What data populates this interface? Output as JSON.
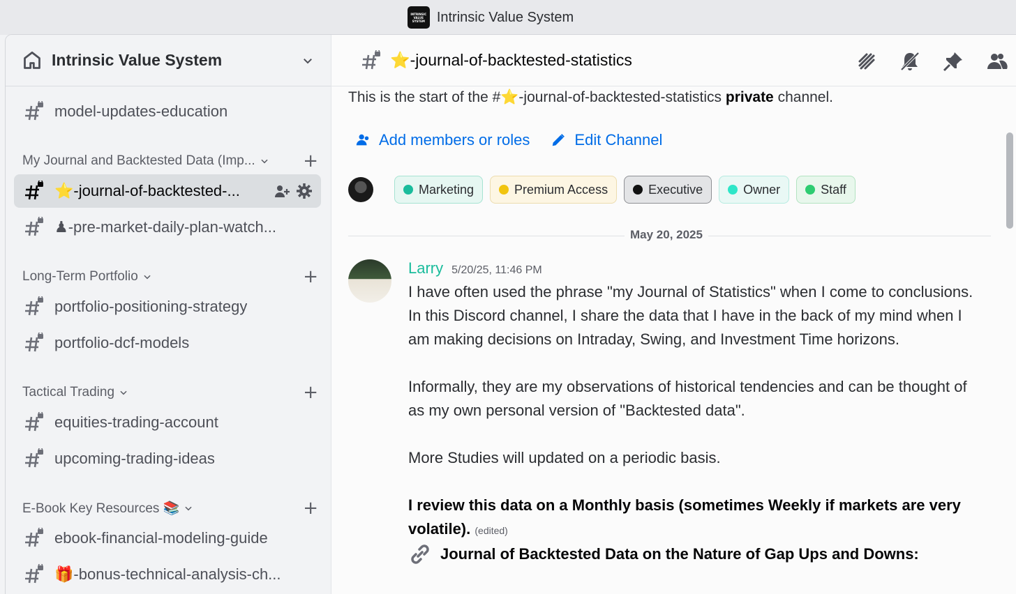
{
  "window": {
    "title": "Intrinsic Value System",
    "logo_text": "INTRINSIC VALUE SYSTEM"
  },
  "sidebar": {
    "server_name": "Intrinsic Value System",
    "top_channel": "model-updates-education",
    "categories": [
      {
        "label": "My Journal and Backtested Data (Imp...",
        "channels": [
          "⭐-journal-of-backtested-...",
          "♟-pre-market-daily-plan-watch..."
        ]
      },
      {
        "label": "Long-Term Portfolio",
        "channels": [
          "portfolio-positioning-strategy",
          "portfolio-dcf-models"
        ]
      },
      {
        "label": "Tactical Trading",
        "channels": [
          "equities-trading-account",
          "upcoming-trading-ideas"
        ]
      },
      {
        "label": "E-Book Key Resources 📚",
        "channels": [
          "ebook-financial-modeling-guide",
          "🎁-bonus-technical-analysis-ch..."
        ]
      }
    ]
  },
  "main": {
    "channel_title": "⭐-journal-of-backtested-statistics",
    "intro_prefix": "This is the start of the #⭐-journal-of-backtested-statistics",
    "intro_bold": "private",
    "intro_suffix": "channel.",
    "add_members_label": "Add members or roles",
    "edit_channel_label": "Edit Channel",
    "roles": [
      {
        "name": "Marketing",
        "color": "#1abc9c",
        "bg": "#e6f7f2",
        "border": "#a6e3d2"
      },
      {
        "name": "Premium Access",
        "color": "#f1c40f",
        "bg": "#fdf6e3",
        "border": "#ecdcae"
      },
      {
        "name": "Executive",
        "color": "#111111",
        "bg": "#e3e4e6",
        "border": "#8e9094"
      },
      {
        "name": "Owner",
        "color": "#2ee6c8",
        "bg": "#e9f8f5",
        "border": "#b5ebe0"
      },
      {
        "name": "Staff",
        "color": "#2ecc71",
        "bg": "#e8f7ec",
        "border": "#b3e3c1"
      }
    ],
    "date_divider": "May 20, 2025",
    "message": {
      "author": "Larry",
      "timestamp": "5/20/25, 11:46 PM",
      "para1": "I have often used the phrase \"my Journal of Statistics\" when I come to conclusions. In this Discord channel, I share the data that I have in the back of my mind when I am making decisions on Intraday, Swing, and Investment Time horizons.",
      "para2": "Informally, they are my observations of historical tendencies and can be thought of as my own personal version of \"Backtested data\".",
      "para3": "More Studies will updated on a periodic basis.",
      "bold_line": "I review this data on a Monthly basis (sometimes Weekly if markets are very volatile).",
      "edited": "(edited)",
      "link_line": "Journal of Backtested Data on the Nature of Gap Ups and Downs:"
    }
  }
}
